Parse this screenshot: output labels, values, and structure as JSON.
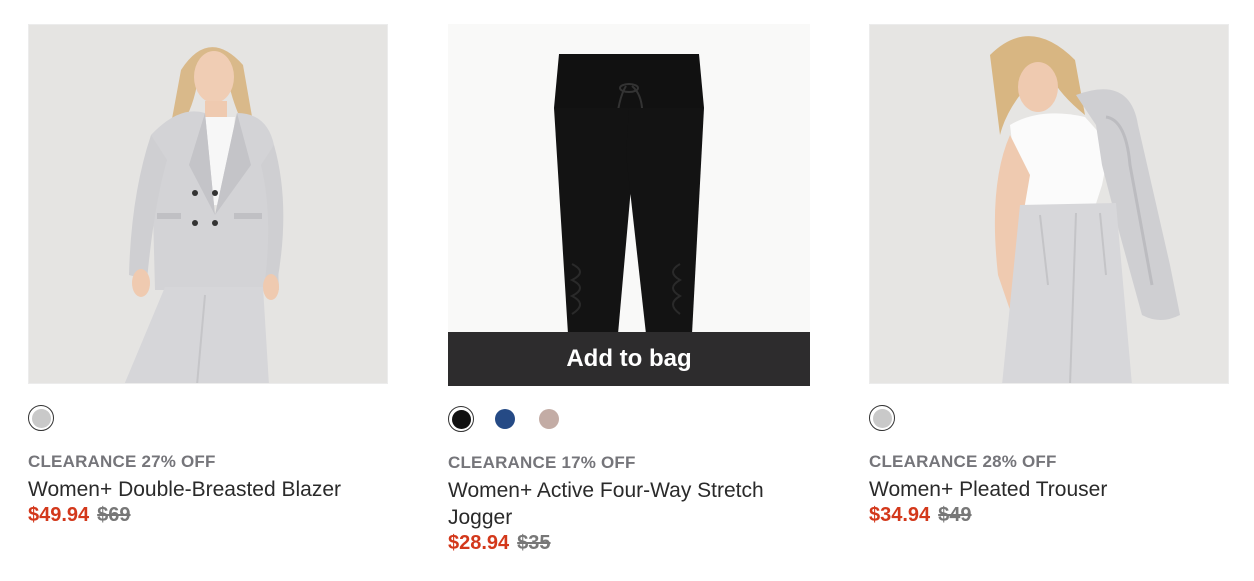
{
  "products": [
    {
      "badge": "CLEARANCE 27% OFF",
      "title": "Women+ Double-Breasted Blazer",
      "sale_price": "$49.94",
      "original_price": "$69",
      "swatches": [
        {
          "color": "#c9c9c9",
          "selected": true
        }
      ]
    },
    {
      "badge": "CLEARANCE 17% OFF",
      "title": "Women+ Active Four-Way Stretch Jogger",
      "sale_price": "$28.94",
      "original_price": "$35",
      "add_to_bag": "Add to bag",
      "swatches": [
        {
          "color": "#111111",
          "selected": true
        },
        {
          "color": "#254a85",
          "selected": false
        },
        {
          "color": "#c3aca5",
          "selected": false
        }
      ]
    },
    {
      "badge": "CLEARANCE 28% OFF",
      "title": "Women+ Pleated Trouser",
      "sale_price": "$34.94",
      "original_price": "$49",
      "swatches": [
        {
          "color": "#c9c9c9",
          "selected": true
        }
      ]
    }
  ],
  "colors": {
    "sale": "#d3381b",
    "badge": "#75757a",
    "overlay": "#2d2c2d"
  }
}
